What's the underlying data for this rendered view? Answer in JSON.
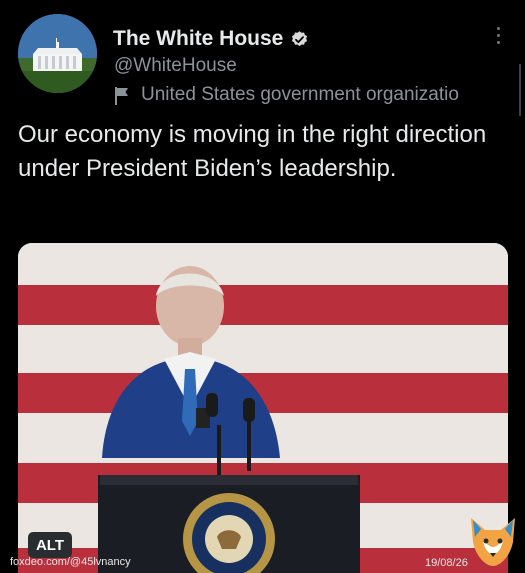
{
  "account": {
    "name": "The White House",
    "handle": "@WhiteHouse",
    "label": "United States government organizatio"
  },
  "post": {
    "text": "Our economy is moving in the right direction under President Biden’s leadership."
  },
  "media": {
    "alt_badge": "ALT"
  },
  "overlay": {
    "watermark": "foxdeo.com/@45lvnancy",
    "date": "19/08/26"
  },
  "colors": {
    "background": "#000000",
    "text": "#e7e9ea",
    "secondary_text": "#8b9298",
    "verified_badge": "#d9d9d9",
    "flag_red": "#b92f3b"
  },
  "icons": [
    "white-house-avatar",
    "verified-badge-icon",
    "gov-flag-icon",
    "more-options-icon",
    "fox-logo-icon"
  ]
}
